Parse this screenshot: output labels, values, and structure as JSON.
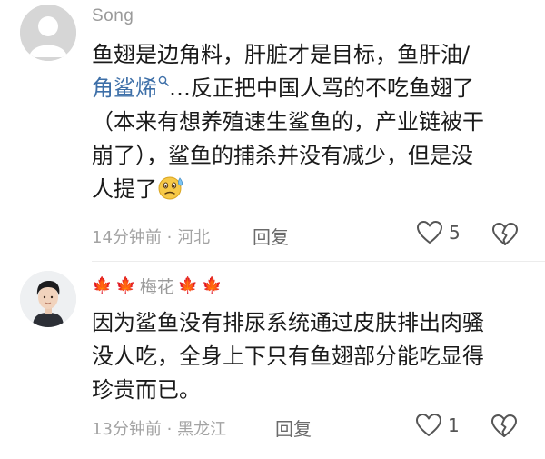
{
  "comments": [
    {
      "username": "Song",
      "lines": [
        "鱼翅是边角料，肝脏才是目标，鱼肝油/",
        "…反正把中国人骂的不吃鱼翅了",
        "（本来有想养殖速生鲨鱼的，产业链被干",
        "崩了），鲨鱼的捕杀并没有减少，但是没",
        "人提了"
      ],
      "link_text": "角鲨烯",
      "time": "14分钟前",
      "location": "河北",
      "reply_label": "回复",
      "likes": "5"
    },
    {
      "username": "梅花",
      "lines": [
        "因为鲨鱼没有排尿系统通过皮肤排出肉骚",
        "没人吃，全身上下只有鱼翅部分能吃显得",
        "珍贵而已。"
      ],
      "time": "13分钟前",
      "location": "黑龙江",
      "reply_label": "回复",
      "likes": "1"
    }
  ],
  "icons": {
    "search": "search-icon",
    "emoji": "sweat-face-emoji",
    "like": "heart-icon",
    "dislike": "broken-heart-icon",
    "decoration": "maple-leaf-icon"
  },
  "colors": {
    "link": "#3d6fa8",
    "meta": "#a3a3a3",
    "maple": "#f2a98a"
  }
}
